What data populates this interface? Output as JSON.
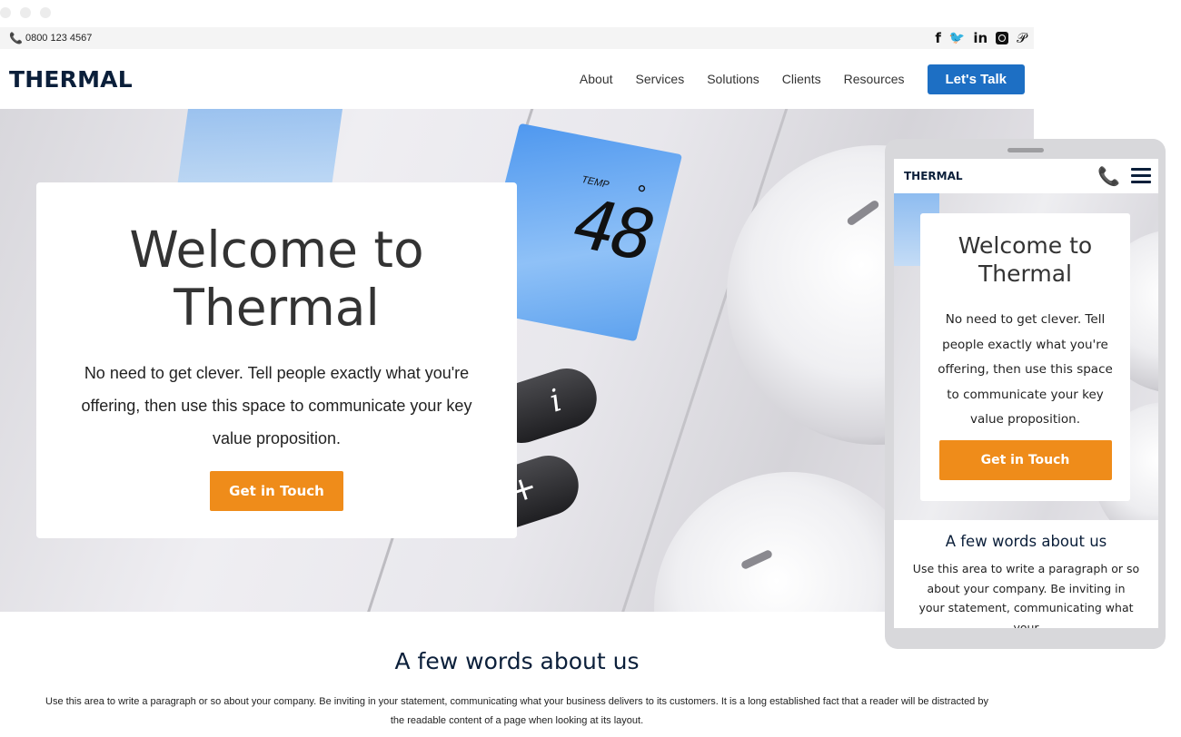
{
  "topbar": {
    "phone_icon": "phone-icon",
    "phone": "0800 123 4567",
    "social_icons": [
      "facebook-icon",
      "twitter-icon",
      "linkedin-icon",
      "instagram-icon",
      "pinterest-icon"
    ]
  },
  "header": {
    "logo": "THERMAL",
    "nav": [
      "About",
      "Services",
      "Solutions",
      "Clients",
      "Resources"
    ],
    "cta": "Let's Talk"
  },
  "hero": {
    "title": "Welcome to Thermal",
    "text": "No need to get clever. Tell people exactly what you're offering, then use this space to communicate your key value proposition.",
    "button": "Get in Touch",
    "display_label": "TEMP",
    "display_value": "48"
  },
  "about": {
    "title": "A few words about us",
    "text": "Use this area to write a paragraph or so about your company. Be inviting in your statement, communicating what your business delivers to its customers. It is a long established fact that a reader will be distracted by the readable content of a page when looking at its layout."
  },
  "mobile": {
    "logo": "THERMAL",
    "title": "Welcome to Thermal",
    "text": "No need to get clever. Tell people exactly what you're offering, then use this space to communicate your key value proposition.",
    "button": "Get in Touch",
    "about_title": "A few words about us",
    "about_text": "Use this area to write a paragraph or so about your company. Be inviting in your statement, communicating what your"
  },
  "colors": {
    "brand_navy": "#0b1f3a",
    "nav_button": "#1d6fc4",
    "cta_orange": "#ef8c1a"
  }
}
